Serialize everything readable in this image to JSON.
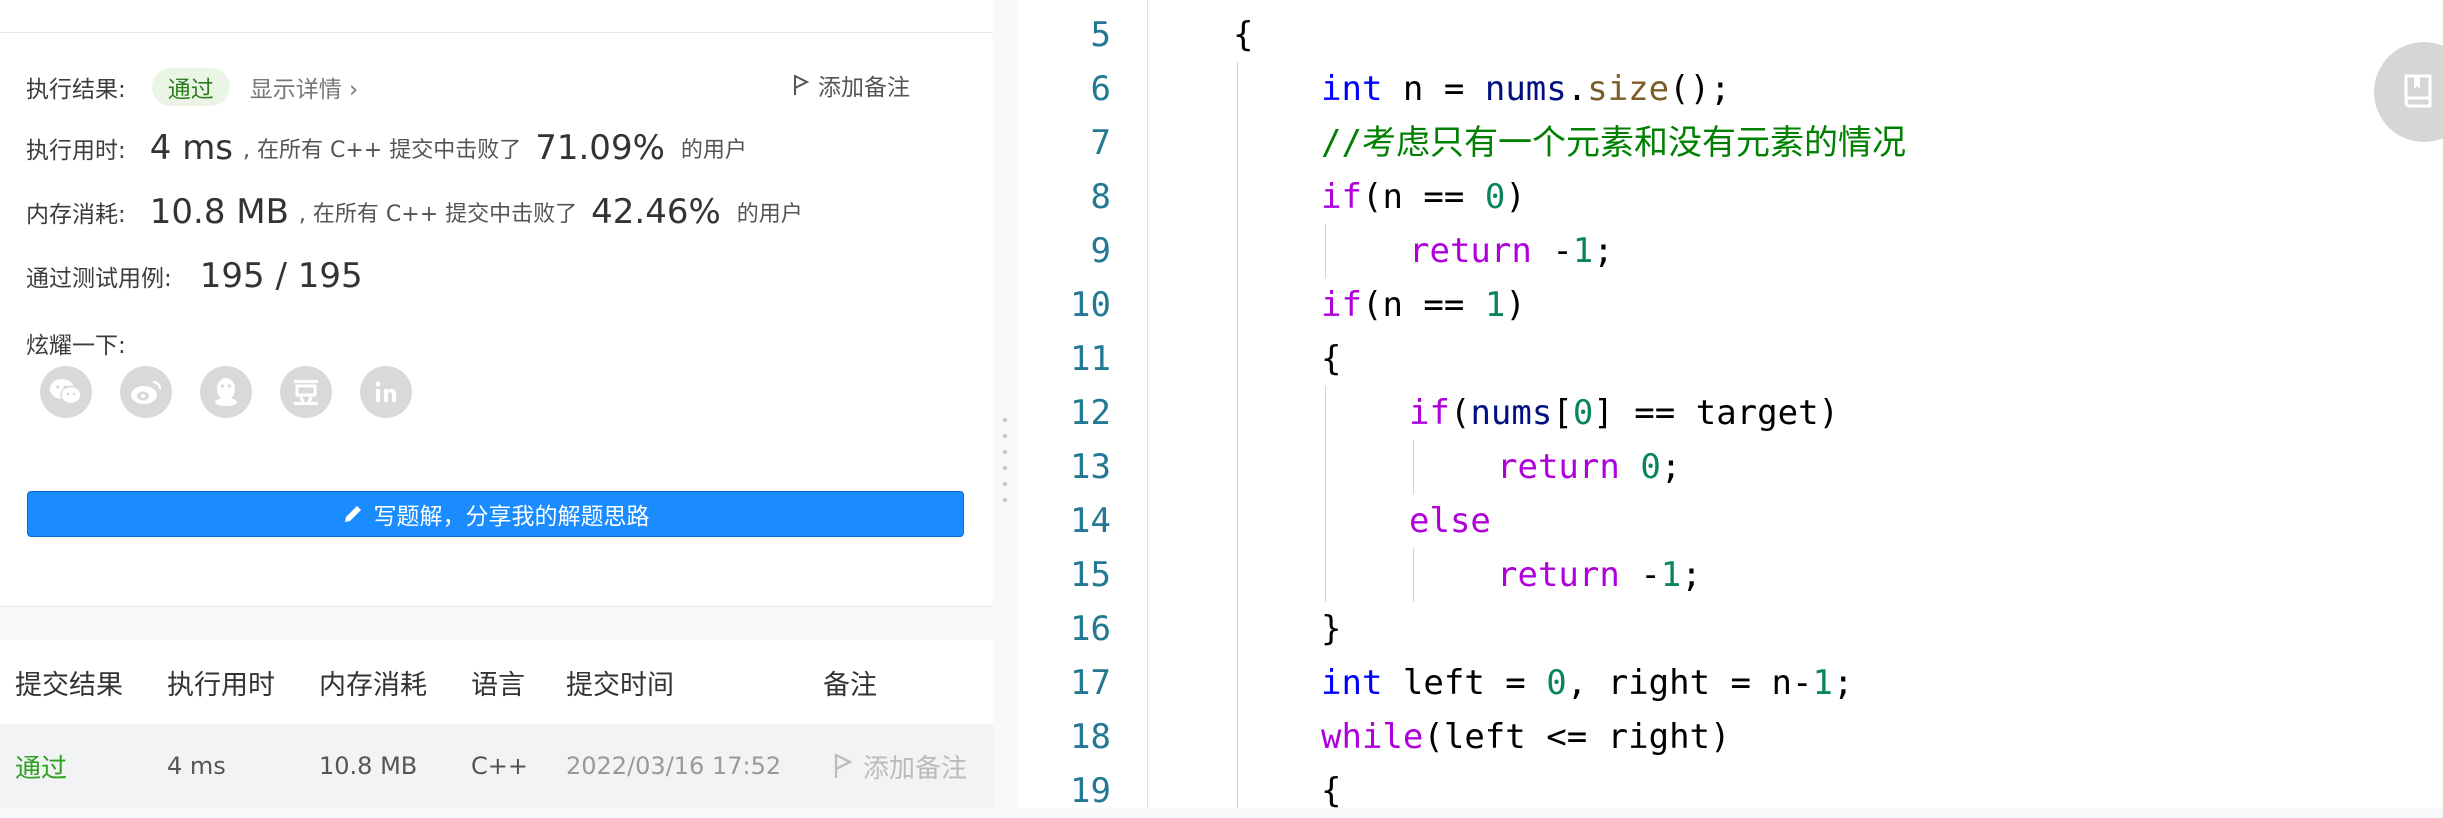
{
  "result": {
    "status_label": "执行结果:",
    "status_value": "通过",
    "details_link": "显示详情 ›",
    "add_note": "添加备注",
    "runtime_label": "执行用时:",
    "runtime_value": "4 ms",
    "beat_prefix": ", 在所有 C++ 提交中击败了",
    "runtime_percent": "71.09%",
    "users_suffix": "的用户",
    "memory_label": "内存消耗:",
    "memory_value": "10.8 MB",
    "memory_percent": "42.46%",
    "cases_label": "通过测试用例:",
    "cases_value": "195 / 195",
    "share_label": "炫耀一下:",
    "share_icons": [
      "wechat-icon",
      "weibo-icon",
      "qq-icon",
      "douban-icon",
      "linkedin-icon"
    ],
    "write_solution": "写题解，分享我的解题思路"
  },
  "submissions": {
    "headers": [
      "提交结果",
      "执行用时",
      "内存消耗",
      "语言",
      "提交时间",
      "备注"
    ],
    "rows": [
      {
        "status": "通过",
        "runtime": "4 ms",
        "memory": "10.8 MB",
        "lang": "C++",
        "time": "2022/03/16 17:52",
        "note": "添加备注"
      }
    ]
  },
  "editor": {
    "line_numbers": [
      "5",
      "6",
      "7",
      "8",
      "9",
      "10",
      "11",
      "12",
      "13",
      "14",
      "15",
      "16",
      "17",
      "18",
      "19"
    ],
    "lines": [
      "{",
      "int n = nums.size();",
      "//考虑只有一个元素和没有元素的情况",
      "if(n == 0)",
      "return -1;",
      "if(n == 1)",
      "{",
      "if(nums[0] == target)",
      "return 0;",
      "else",
      "return -1;",
      "}",
      "int left = 0, right = n-1;",
      "while(left <= right)",
      "{"
    ]
  },
  "colors": {
    "accent_button": "#1a8cff",
    "pass_green": "#2ea121",
    "line_number": "#237893",
    "keyword_type": "#0000ff",
    "keyword_control": "#af00db",
    "number": "#098658",
    "comment": "#008000"
  }
}
